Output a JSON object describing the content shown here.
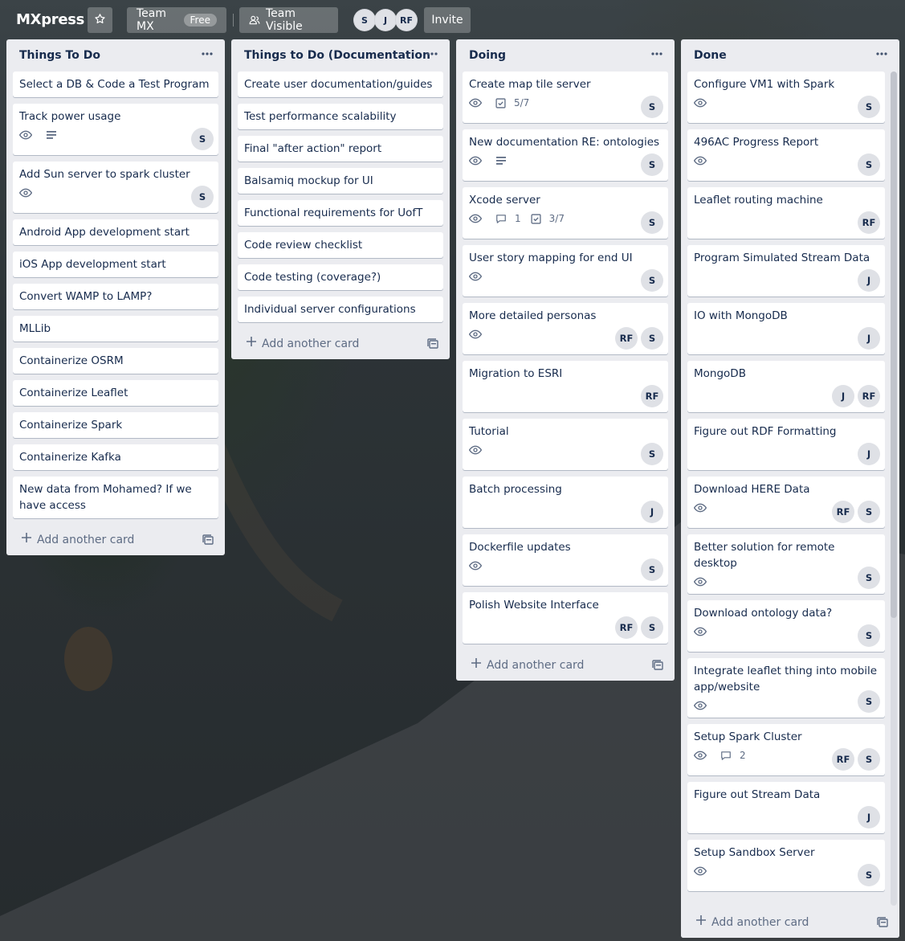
{
  "header": {
    "brand": "MXpress",
    "team_name": "Team MX",
    "team_plan": "Free",
    "visibility": "Team Visible",
    "members": [
      "S",
      "J",
      "RF"
    ],
    "invite": "Invite"
  },
  "lists": [
    {
      "title": "Things To Do",
      "add_label": "Add another card",
      "cards": [
        {
          "title": "Select a DB & Code a Test Program"
        },
        {
          "title": "Track power usage",
          "watch": true,
          "desc": true,
          "members": [
            "S"
          ]
        },
        {
          "title": "Add Sun server to spark cluster",
          "watch": true,
          "members": [
            "S"
          ]
        },
        {
          "title": "Android App development start"
        },
        {
          "title": "iOS App development start"
        },
        {
          "title": "Convert WAMP to LAMP?"
        },
        {
          "title": "MLLib"
        },
        {
          "title": "Containerize OSRM"
        },
        {
          "title": "Containerize Leaflet"
        },
        {
          "title": "Containerize Spark"
        },
        {
          "title": "Containerize Kafka"
        },
        {
          "title": "New data from Mohamed? If we have access"
        }
      ]
    },
    {
      "title": "Things to Do (Documentation",
      "add_label": "Add another card",
      "cards": [
        {
          "title": "Create user documentation/guides"
        },
        {
          "title": "Test performance scalability"
        },
        {
          "title": "Final \"after action\" report"
        },
        {
          "title": "Balsamiq mockup for UI"
        },
        {
          "title": "Functional requirements for UofT"
        },
        {
          "title": "Code review checklist"
        },
        {
          "title": "Code testing (coverage?)"
        },
        {
          "title": "Individual server configurations"
        }
      ]
    },
    {
      "title": "Doing",
      "add_label": "Add another card",
      "cards": [
        {
          "title": "Create map tile server",
          "watch": true,
          "checklist": "5/7",
          "members": [
            "S"
          ]
        },
        {
          "title": "New documentation RE: ontologies",
          "watch": true,
          "desc": true,
          "members": [
            "S"
          ]
        },
        {
          "title": "Xcode server",
          "watch": true,
          "comments": "1",
          "checklist": "3/7",
          "members": [
            "S"
          ]
        },
        {
          "title": "User story mapping for end UI",
          "watch": true,
          "members": [
            "S"
          ]
        },
        {
          "title": "More detailed personas",
          "watch": true,
          "members": [
            "RF",
            "S"
          ]
        },
        {
          "title": "Migration to ESRI",
          "members": [
            "RF"
          ]
        },
        {
          "title": "Tutorial",
          "watch": true,
          "members": [
            "S"
          ]
        },
        {
          "title": "Batch processing",
          "members": [
            "J"
          ]
        },
        {
          "title": "Dockerfile updates",
          "watch": true,
          "members": [
            "S"
          ]
        },
        {
          "title": "Polish Website Interface",
          "members": [
            "RF",
            "S"
          ]
        }
      ]
    },
    {
      "title": "Done",
      "add_label": "Add another card",
      "cards": [
        {
          "title": "Configure VM1 with Spark",
          "watch": true,
          "members": [
            "S"
          ]
        },
        {
          "title": "496AC Progress Report",
          "watch": true,
          "members": [
            "S"
          ]
        },
        {
          "title": "Leaflet routing machine",
          "members": [
            "RF"
          ]
        },
        {
          "title": "Program Simulated Stream Data",
          "members": [
            "J"
          ]
        },
        {
          "title": "IO with MongoDB",
          "members": [
            "J"
          ]
        },
        {
          "title": "MongoDB",
          "members": [
            "J",
            "RF"
          ]
        },
        {
          "title": "Figure out RDF Formatting",
          "members": [
            "J"
          ]
        },
        {
          "title": "Download HERE Data",
          "watch": true,
          "members": [
            "RF",
            "S"
          ]
        },
        {
          "title": "Better solution for remote desktop",
          "watch": true,
          "members": [
            "S"
          ]
        },
        {
          "title": "Download ontology data?",
          "watch": true,
          "members": [
            "S"
          ]
        },
        {
          "title": "Integrate leaflet thing into mobile app/website",
          "watch": true,
          "members": [
            "S"
          ]
        },
        {
          "title": "Setup Spark Cluster",
          "watch": true,
          "comments": "2",
          "members": [
            "RF",
            "S"
          ]
        },
        {
          "title": "Figure out Stream Data",
          "members": [
            "J"
          ]
        },
        {
          "title": "Setup Sandbox Server",
          "watch": true,
          "members": [
            "S"
          ]
        }
      ]
    }
  ]
}
